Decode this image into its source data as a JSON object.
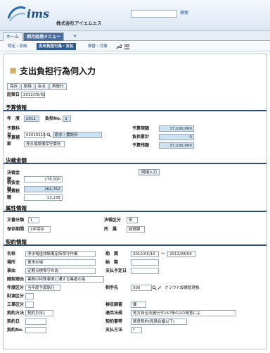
{
  "header": {
    "logo": "ims",
    "company": "株式会社アイエムエス",
    "search_label": "検索",
    "search_value": ""
  },
  "tabs": [
    "ホーム",
    "例月処理メニュー",
    "+"
  ],
  "subtabs": [
    "調定・収納",
    "支出負担行為・支払",
    "振替・月報"
  ],
  "page": {
    "title": "支出負担行為伺入力",
    "buttons": [
      "保存",
      "削除",
      "戻る",
      "再発行"
    ],
    "date_label": "起案日",
    "date_value": "2012/05/01"
  },
  "budget": {
    "heading": "予算情報",
    "year_label": "年　度",
    "year_value": "2012",
    "num_label": "負担No.",
    "num_value": "1",
    "account_label": "予算科目",
    "account_code": "02010116",
    "account_name": "原水・委託料",
    "supp_label": "予算補節",
    "supp_value": "浄水場設備保守委託",
    "budget_label": "予算現額",
    "budget_value": "37,100,000",
    "spent_label": "負担累計",
    "spent_value": "0",
    "remain_label": "予算残額",
    "remain_value": "37,100,000"
  },
  "amount": {
    "heading": "決裁金額",
    "decision_label": "決裁金額",
    "decision_value": "278,000",
    "detail_button": "明細入力",
    "tax_excl_label": "税抜金額",
    "tax_excl_value": "264,762",
    "tax_label": "消費税額",
    "tax_value": "13,238"
  },
  "attributes": {
    "heading": "属性情報",
    "doc_label": "文書分類",
    "doc_value": "1",
    "decide_label": "決裁区分",
    "decide_value": "甲",
    "retention_label": "保存期間",
    "retention_value": "1年保存",
    "dept_label": "所　属",
    "dept_value": "経理課"
  },
  "contract": {
    "heading": "契約情報",
    "name_label": "名称",
    "name_value": "浄水場送排設備定時保守作業",
    "location_label": "場所",
    "location_value": "東浄水場",
    "reason_label": "事由",
    "reason_value": "定期点検保守の為",
    "method_label": "随契理由",
    "method_value": "業務の特殊事情に通ずる業者の為",
    "year_cat_label": "年度区分",
    "year_cat_value": "当年度予算執行",
    "fin_label": "財源区分",
    "work_label": "工事区分",
    "contract_method_label": "契約方法",
    "contract_method_value": "契約方法1",
    "contract_date_label": "契約日",
    "contract_no_label": "契約No.",
    "period_label": "期　間",
    "period_from": "2012/05/10",
    "period_sep": "〜",
    "period_to": "2012/08/09",
    "deliver_label": "納　期",
    "pay_date_label": "支払予定日",
    "partner_label": "相手先",
    "partner_code": "500",
    "partner_name": "クラウド設備管理株",
    "survey_label": "検収調書",
    "survey_value": "要",
    "law_label": "適用法規",
    "law_value": "地方自治法施行令167条の2の随意によ",
    "format_label": "契約書等",
    "format_value": "随意契約(見積合議以下)",
    "pay_method_label": "支払方法",
    "pay_method_value": "*"
  }
}
